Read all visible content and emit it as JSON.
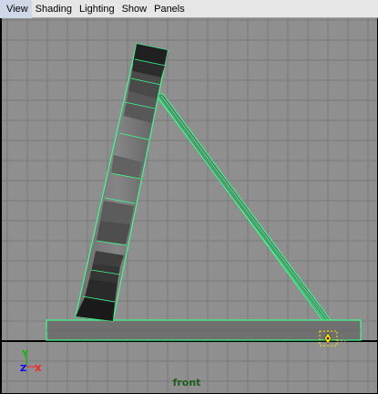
{
  "menubar": {
    "items": [
      {
        "label": "View"
      },
      {
        "label": "Shading"
      },
      {
        "label": "Lighting"
      },
      {
        "label": "Show"
      },
      {
        "label": "Panels"
      }
    ]
  },
  "viewport": {
    "camera_name": "front",
    "axis": {
      "y_label": "Y",
      "z_label": "Z",
      "x_label": "X",
      "y_color": "#00c000",
      "z_color": "#0000ff",
      "x_color": "#ff2020"
    },
    "colors": {
      "background": "#8f8f8f",
      "grid": "#7a7a7a",
      "origin_line": "#000000",
      "selection_wire": "#3cff8a",
      "mesh_dark": "#3a3a3a",
      "mesh_mid": "#6a6a6a",
      "locator": "#ffe000"
    }
  }
}
